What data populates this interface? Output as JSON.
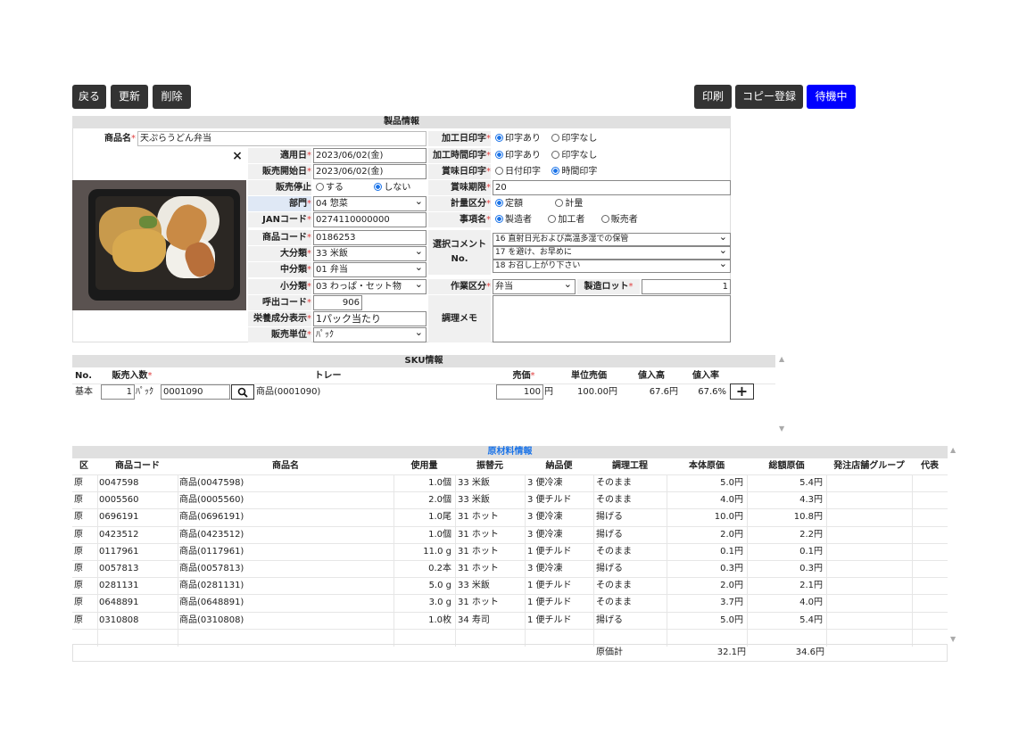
{
  "toolbar": {
    "back": "戻る",
    "update": "更新",
    "delete": "削除",
    "print": "印刷",
    "copy_register": "コピー登録",
    "status": "待機中"
  },
  "product": {
    "section_title": "製品情報",
    "name_label": "商品名",
    "name_value": "天ぷらうどん弁当",
    "close_icon": "×",
    "apply_date_label": "適用日",
    "apply_date": "2023/06/02(金)",
    "sale_start_label": "販売開始日",
    "sale_start": "2023/06/02(金)",
    "sale_stop_label": "販売停止",
    "sale_stop_opt1": "する",
    "sale_stop_opt2": "しない",
    "dept_label": "部門",
    "dept": "04 惣菜",
    "jan_label": "JANコード",
    "jan": "0274110000000",
    "code_label": "商品コード",
    "code": "0186253",
    "major_label": "大分類",
    "major": "33 米飯",
    "middle_label": "中分類",
    "middle": "01 弁当",
    "minor_label": "小分類",
    "minor": "03 わっぱ・セット物",
    "call_label": "呼出コード",
    "call": "906",
    "nutrition_label": "栄養成分表示",
    "nutrition": "1パック当たり",
    "unit_label": "販売単位",
    "unit": "ﾊﾟｯｸ",
    "proc_date_label": "加工日印字",
    "proc_date_opt1": "印字あり",
    "proc_date_opt2": "印字なし",
    "proc_time_label": "加工時間印字",
    "proc_time_opt1": "印字あり",
    "proc_time_opt2": "印字なし",
    "best_before_label": "賞味日印字",
    "best_before_opt1": "日付印字",
    "best_before_opt2": "時間印字",
    "shelf_label": "賞味期限",
    "shelf": "20",
    "weigh_label": "計量区分",
    "weigh_opt1": "定額",
    "weigh_opt2": "計量",
    "item_label": "事項名",
    "item_opt1": "製造者",
    "item_opt2": "加工者",
    "item_opt3": "販売者",
    "comment_label": "選択コメント",
    "comment_label2": "No.",
    "comment1": "16 直射日光および高温多湿での保管",
    "comment2": "17 を避け、お早めに",
    "comment3": "18 お召し上がり下さい",
    "work_label": "作業区分",
    "work": "弁当",
    "lot_label": "製造ロット",
    "lot": "1",
    "memo_label": "調理メモ",
    "required_mark": "*"
  },
  "sku": {
    "section_title": "SKU情報",
    "headers": {
      "no": "No.",
      "qty": "販売入数",
      "tray": "トレー",
      "price": "売価",
      "unit_price": "単位売価",
      "markup_amt": "値入高",
      "markup_rate": "値入率"
    },
    "row": {
      "no": "基本",
      "qty": "1",
      "qty_unit": "ﾊﾟｯｸ",
      "tray_code": "0001090",
      "tray_name": "商品(0001090)",
      "price": "100",
      "price_unit": "円",
      "unit_price": "100.00円",
      "markup_amt": "67.6円",
      "markup_rate": "67.6%"
    },
    "add_icon": "+"
  },
  "materials": {
    "section_title": "原材料情報",
    "headers": [
      "区",
      "商品コード",
      "商品名",
      "使用量",
      "振替元",
      "納品便",
      "調理工程",
      "本体原価",
      "総額原価",
      "発注店舗グループ",
      "代表"
    ],
    "rows": [
      [
        "原",
        "0047598",
        "商品(0047598)",
        "1.0個",
        "33 米飯",
        "3 便冷凍",
        "そのまま",
        "5.0円",
        "5.4円"
      ],
      [
        "原",
        "0005560",
        "商品(0005560)",
        "2.0個",
        "33 米飯",
        "3 便チルド",
        "そのまま",
        "4.0円",
        "4.3円"
      ],
      [
        "原",
        "0696191",
        "商品(0696191)",
        "1.0尾",
        "31 ホット",
        "3 便冷凍",
        "揚げる",
        "10.0円",
        "10.8円"
      ],
      [
        "原",
        "0423512",
        "商品(0423512)",
        "1.0個",
        "31 ホット",
        "3 便冷凍",
        "揚げる",
        "2.0円",
        "2.2円"
      ],
      [
        "原",
        "0117961",
        "商品(0117961)",
        "11.0 g",
        "31 ホット",
        "1 便チルド",
        "そのまま",
        "0.1円",
        "0.1円"
      ],
      [
        "原",
        "0057813",
        "商品(0057813)",
        "0.2本",
        "31 ホット",
        "3 便冷凍",
        "揚げる",
        "0.3円",
        "0.3円"
      ],
      [
        "原",
        "0281131",
        "商品(0281131)",
        "5.0 g",
        "33 米飯",
        "1 便チルド",
        "そのまま",
        "2.0円",
        "2.1円"
      ],
      [
        "原",
        "0648891",
        "商品(0648891)",
        "3.0 g",
        "31 ホット",
        "1 便チルド",
        "そのまま",
        "3.7円",
        "4.0円"
      ],
      [
        "原",
        "0310808",
        "商品(0310808)",
        "1.0枚",
        "34 寿司",
        "1 便チルド",
        "揚げる",
        "5.0円",
        "5.4円"
      ]
    ],
    "footer": {
      "label": "原価計",
      "base_total": "32.1円",
      "gross_total": "34.6円"
    }
  },
  "colors": {
    "accent": "#0000ff",
    "header_bg": "#e0e0e0",
    "button_bg": "#333333",
    "required": "#e04040",
    "link_title": "#1a73e8"
  }
}
